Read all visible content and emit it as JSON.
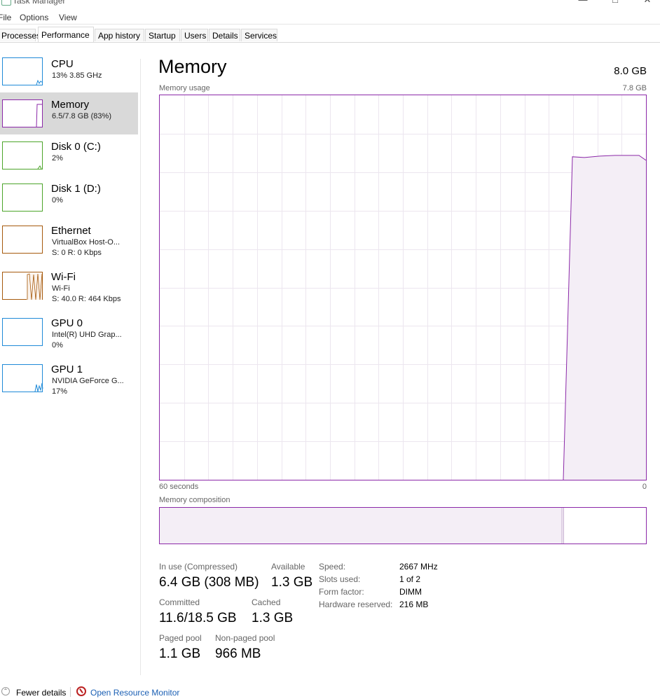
{
  "window": {
    "title": "Task Manager"
  },
  "menu": [
    "File",
    "Options",
    "View"
  ],
  "tabs": [
    {
      "label": "Processes"
    },
    {
      "label": "Performance"
    },
    {
      "label": "App history"
    },
    {
      "label": "Startup"
    },
    {
      "label": "Users"
    },
    {
      "label": "Details"
    },
    {
      "label": "Services"
    }
  ],
  "active_tab": "Performance",
  "sidebar": {
    "items": [
      {
        "title": "CPU",
        "line1": "13%  3.85 GHz",
        "line2": ""
      },
      {
        "title": "Memory",
        "line1": "6.5/7.8 GB (83%)",
        "line2": ""
      },
      {
        "title": "Disk 0 (C:)",
        "line1": "2%",
        "line2": ""
      },
      {
        "title": "Disk 1 (D:)",
        "line1": "0%",
        "line2": ""
      },
      {
        "title": "Ethernet",
        "line1": "VirtualBox Host-O...",
        "line2": "S: 0  R: 0 Kbps"
      },
      {
        "title": "Wi-Fi",
        "line1": "Wi-Fi",
        "line2": "S: 40.0  R: 464 Kbps"
      },
      {
        "title": "GPU 0",
        "line1": "Intel(R) UHD Grap...",
        "line2": "0%"
      },
      {
        "title": "GPU 1",
        "line1": "NVIDIA GeForce G...",
        "line2": "17%"
      }
    ],
    "colors": {
      "cpu": "#1f8ad8",
      "memory": "#8b28a8",
      "disk": "#4ca52a",
      "ethernet": "#a65a0d",
      "wifi": "#a65a0d",
      "gpu": "#1f8ad8"
    }
  },
  "main": {
    "title": "Memory",
    "total": "8.0 GB",
    "usage_label": "Memory usage",
    "usage_max": "7.8 GB",
    "time_left": "60 seconds",
    "time_right": "0",
    "composition_label": "Memory composition",
    "graph_color": "#8b28a8",
    "graph_fill": "#f4eef6",
    "usage_level": 0.84,
    "composition_in_use_fraction": 0.83
  },
  "stats": {
    "in_use_label": "In use (Compressed)",
    "in_use_value": "6.4 GB (308 MB)",
    "available_label": "Available",
    "available_value": "1.3 GB",
    "committed_label": "Committed",
    "committed_value": "11.6/18.5 GB",
    "cached_label": "Cached",
    "cached_value": "1.3 GB",
    "paged_label": "Paged pool",
    "paged_value": "1.1 GB",
    "nonpaged_label": "Non-paged pool",
    "nonpaged_value": "966 MB"
  },
  "specs": [
    {
      "label": "Speed:",
      "value": "2667 MHz"
    },
    {
      "label": "Slots used:",
      "value": "1 of 2"
    },
    {
      "label": "Form factor:",
      "value": "DIMM"
    },
    {
      "label": "Hardware reserved:",
      "value": "216 MB"
    }
  ],
  "footer": {
    "fewer_details": "Fewer details",
    "open_monitor": "Open Resource Monitor"
  }
}
